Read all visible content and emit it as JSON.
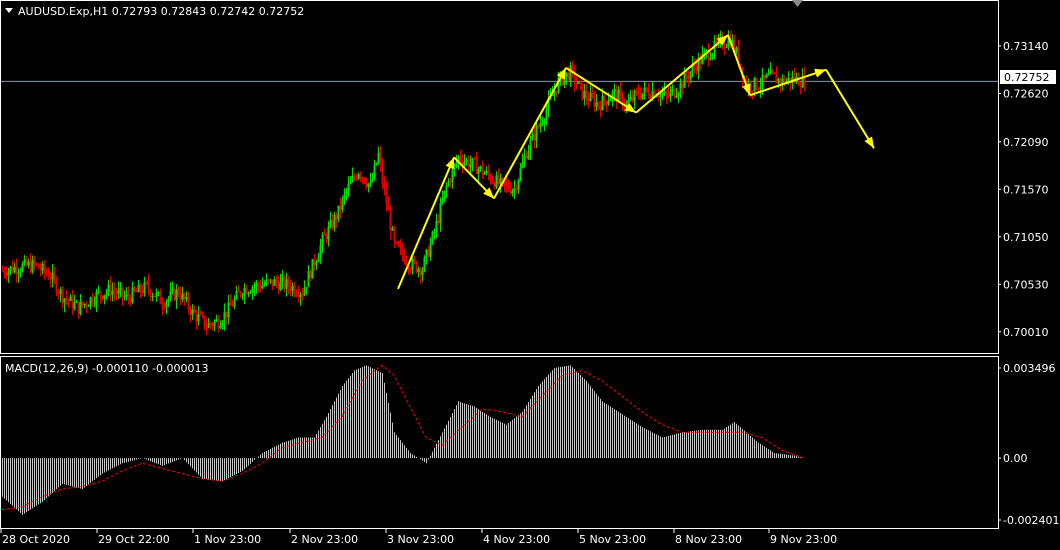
{
  "header": {
    "symbol_line": "AUDUSD.Exp,H1  0.72793 0.72843 0.72742 0.72752"
  },
  "macd_header": "MACD(12,26,9) -0.000110 -0.000013",
  "colors": {
    "background": "#000000",
    "frame": "#ffffff",
    "bull_candle": "#00e000",
    "bear_candle": "#e00000",
    "wave_arrows": "#ffff00",
    "macd_hist": "#c8c8c8",
    "macd_signal": "#ff0000",
    "bid_line": "#8a9ab0"
  },
  "chart_data": [
    {
      "type": "candlestick",
      "symbol": "AUDUSD.Exp",
      "timeframe": "H1",
      "last_ohlc": {
        "open": 0.72793,
        "high": 0.72843,
        "low": 0.72742,
        "close": 0.72752
      },
      "current_price_label": "0.72752",
      "current_price": 0.72752,
      "y_ticks": [
        "0.73140",
        "0.72620",
        "0.72090",
        "0.71570",
        "0.71050",
        "0.70530",
        "0.70010"
      ],
      "y_tick_values": [
        0.7314,
        0.7262,
        0.7209,
        0.7157,
        0.7105,
        0.7053,
        0.7001
      ],
      "ylim": [
        0.6992,
        0.7338
      ],
      "x_ticks": [
        "28 Oct 2020",
        "29 Oct 22:00",
        "1 Nov 23:00",
        "2 Nov 23:00",
        "3 Nov 23:00",
        "4 Nov 23:00",
        "5 Nov 23:00",
        "8 Nov 23:00",
        "9 Nov 23:00"
      ],
      "close_path": [
        [
          0,
          0.7068
        ],
        [
          8,
          0.7072
        ],
        [
          16,
          0.7074
        ],
        [
          24,
          0.7062
        ],
        [
          30,
          0.704
        ],
        [
          38,
          0.7027
        ],
        [
          46,
          0.704
        ],
        [
          54,
          0.7047
        ],
        [
          62,
          0.7038
        ],
        [
          72,
          0.705
        ],
        [
          80,
          0.7034
        ],
        [
          88,
          0.7045
        ],
        [
          95,
          0.7022
        ],
        [
          102,
          0.7008
        ],
        [
          108,
          0.7013
        ],
        [
          112,
          0.7022
        ],
        [
          120,
          0.7048
        ],
        [
          128,
          0.7052
        ],
        [
          136,
          0.7055
        ],
        [
          144,
          0.7051
        ],
        [
          150,
          0.7045
        ],
        [
          160,
          0.71
        ],
        [
          168,
          0.7132
        ],
        [
          172,
          0.7155
        ],
        [
          178,
          0.7178
        ],
        [
          184,
          0.716
        ],
        [
          188,
          0.7195
        ],
        [
          190,
          0.7165
        ],
        [
          196,
          0.7095
        ],
        [
          204,
          0.7075
        ],
        [
          210,
          0.707
        ],
        [
          216,
          0.711
        ],
        [
          222,
          0.716
        ],
        [
          228,
          0.7192
        ],
        [
          236,
          0.7183
        ],
        [
          244,
          0.717
        ],
        [
          250,
          0.716
        ],
        [
          256,
          0.7158
        ],
        [
          262,
          0.7198
        ],
        [
          270,
          0.7235
        ],
        [
          278,
          0.7275
        ],
        [
          284,
          0.7285
        ],
        [
          290,
          0.7262
        ],
        [
          298,
          0.725
        ],
        [
          306,
          0.7262
        ],
        [
          312,
          0.725
        ],
        [
          318,
          0.7262
        ],
        [
          326,
          0.7265
        ],
        [
          332,
          0.7258
        ],
        [
          338,
          0.7268
        ],
        [
          346,
          0.7292
        ],
        [
          352,
          0.7305
        ],
        [
          358,
          0.7315
        ],
        [
          364,
          0.7322
        ],
        [
          368,
          0.73
        ],
        [
          372,
          0.727
        ],
        [
          378,
          0.7272
        ],
        [
          384,
          0.728
        ],
        [
          390,
          0.7275
        ],
        [
          396,
          0.7278
        ],
        [
          401,
          0.7275
        ]
      ],
      "wave_points": [
        [
          198,
          0.7048
        ],
        [
          226,
          0.7192
        ],
        [
          246,
          0.7147
        ],
        [
          282,
          0.729
        ],
        [
          317,
          0.7241
        ],
        [
          363,
          0.7326
        ],
        [
          374,
          0.726
        ],
        [
          412,
          0.7288
        ],
        [
          436,
          0.7202
        ]
      ]
    },
    {
      "type": "histogram+line",
      "indicator": "MACD",
      "params": "12,26,9",
      "values": {
        "macd": -0.00011,
        "signal": -1.3e-05
      },
      "y_ticks": [
        "0.003496",
        "0.00",
        "-0.002401"
      ],
      "y_tick_values": [
        0.003496,
        0.0,
        -0.002401
      ],
      "ylim": [
        -0.002401,
        0.003496
      ],
      "histogram_path": [
        [
          0,
          -0.0015
        ],
        [
          10,
          -0.0022
        ],
        [
          20,
          -0.0017
        ],
        [
          30,
          -0.001
        ],
        [
          40,
          -0.0012
        ],
        [
          50,
          -0.0006
        ],
        [
          60,
          -0.0002
        ],
        [
          70,
          0.0
        ],
        [
          80,
          -0.0003
        ],
        [
          90,
          0.0
        ],
        [
          100,
          -0.0008
        ],
        [
          110,
          -0.0009
        ],
        [
          120,
          -0.0005
        ],
        [
          130,
          0.0002
        ],
        [
          140,
          0.0006
        ],
        [
          148,
          0.0008
        ],
        [
          156,
          0.0008
        ],
        [
          162,
          0.0016
        ],
        [
          170,
          0.0028
        ],
        [
          176,
          0.0034
        ],
        [
          182,
          0.0036
        ],
        [
          190,
          0.0033
        ],
        [
          196,
          0.001
        ],
        [
          204,
          0.0002
        ],
        [
          212,
          -0.0002
        ],
        [
          220,
          0.001
        ],
        [
          228,
          0.0022
        ],
        [
          236,
          0.002
        ],
        [
          244,
          0.0016
        ],
        [
          252,
          0.0013
        ],
        [
          260,
          0.0018
        ],
        [
          268,
          0.0028
        ],
        [
          276,
          0.0035
        ],
        [
          284,
          0.0036
        ],
        [
          292,
          0.003
        ],
        [
          300,
          0.0022
        ],
        [
          310,
          0.0017
        ],
        [
          320,
          0.0012
        ],
        [
          330,
          0.0008
        ],
        [
          340,
          0.001
        ],
        [
          350,
          0.0011
        ],
        [
          360,
          0.0011
        ],
        [
          366,
          0.0014
        ],
        [
          372,
          0.001
        ],
        [
          378,
          0.0006
        ],
        [
          386,
          0.0002
        ],
        [
          396,
          0.0001
        ],
        [
          401,
          0.0
        ]
      ],
      "signal_path": [
        [
          0,
          -0.002
        ],
        [
          10,
          -0.0019
        ],
        [
          20,
          -0.0015
        ],
        [
          30,
          -0.0012
        ],
        [
          40,
          -0.0011
        ],
        [
          50,
          -0.0009
        ],
        [
          60,
          -0.0005
        ],
        [
          70,
          -0.0002
        ],
        [
          80,
          -0.0004
        ],
        [
          90,
          -0.0006
        ],
        [
          100,
          -0.0008
        ],
        [
          110,
          -0.0009
        ],
        [
          120,
          -0.0006
        ],
        [
          130,
          -0.0002
        ],
        [
          140,
          0.0004
        ],
        [
          150,
          0.0006
        ],
        [
          160,
          0.0008
        ],
        [
          170,
          0.0016
        ],
        [
          180,
          0.003
        ],
        [
          190,
          0.0036
        ],
        [
          196,
          0.0032
        ],
        [
          204,
          0.002
        ],
        [
          212,
          0.0008
        ],
        [
          220,
          0.0005
        ],
        [
          230,
          0.0012
        ],
        [
          240,
          0.0019
        ],
        [
          250,
          0.0018
        ],
        [
          260,
          0.0016
        ],
        [
          270,
          0.0024
        ],
        [
          280,
          0.0032
        ],
        [
          290,
          0.0034
        ],
        [
          300,
          0.003
        ],
        [
          310,
          0.0024
        ],
        [
          320,
          0.0018
        ],
        [
          330,
          0.0013
        ],
        [
          340,
          0.001
        ],
        [
          350,
          0.001
        ],
        [
          360,
          0.001
        ],
        [
          370,
          0.001
        ],
        [
          380,
          0.0008
        ],
        [
          390,
          0.0003
        ],
        [
          401,
          0.0
        ]
      ]
    }
  ]
}
